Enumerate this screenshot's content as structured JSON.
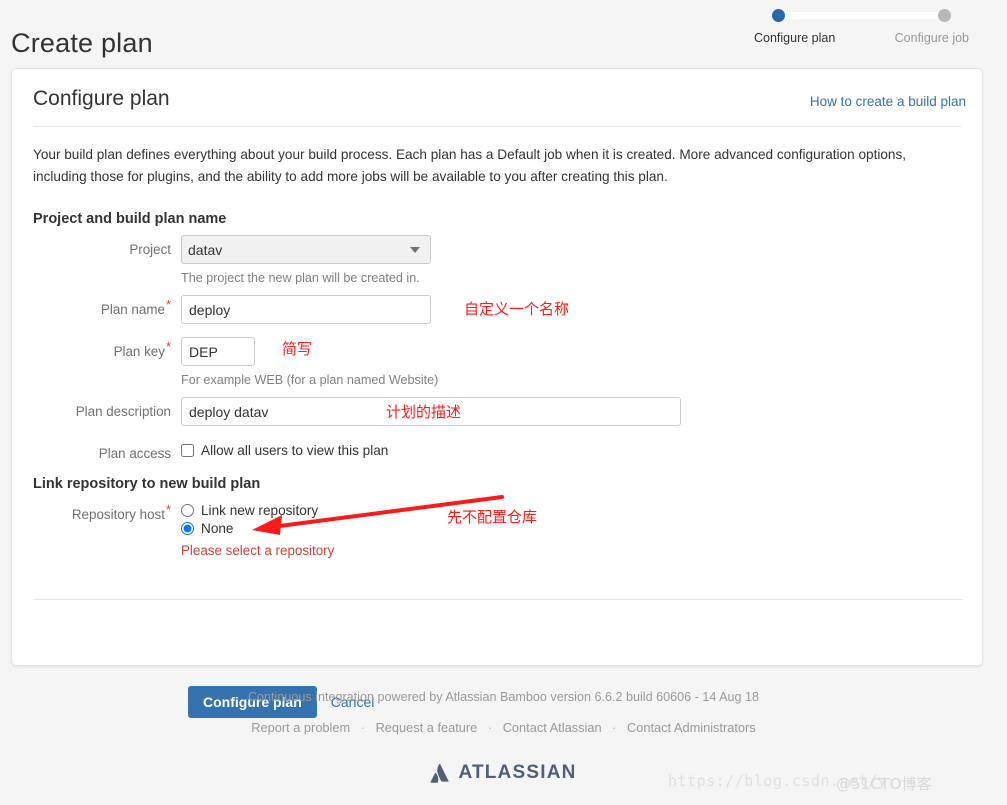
{
  "header": {
    "title": "Create plan",
    "steps": [
      {
        "label": "Configure plan",
        "state": "current"
      },
      {
        "label": "Configure job",
        "state": "upcoming"
      }
    ]
  },
  "card": {
    "title": "Configure plan",
    "help_link": "How to create a build plan",
    "intro": "Your build plan defines everything about your build process. Each plan has a Default job when it is created. More advanced configuration options, including those for plugins, and the ability to add more jobs will be available to you after creating this plan."
  },
  "form": {
    "section1_title": "Project and build plan name",
    "section2_title": "Link repository to new build plan",
    "project": {
      "label": "Project",
      "value": "datav",
      "options": [
        "datav"
      ],
      "hint": "The project the new plan will be created in."
    },
    "plan_name": {
      "label": "Plan name",
      "required": true,
      "value": "deploy",
      "placeholder": ""
    },
    "plan_key": {
      "label": "Plan key",
      "required": true,
      "value": "DEP",
      "placeholder": "",
      "hint": "For example WEB (for a plan named Website)"
    },
    "plan_description": {
      "label": "Plan description",
      "required": false,
      "value": "deploy datav",
      "placeholder": ""
    },
    "plan_access": {
      "label": "Plan access",
      "checkbox_label": "Allow all users to view this plan",
      "checked": false
    },
    "repository_host": {
      "label": "Repository host",
      "required": true,
      "options": [
        {
          "label": "Link new repository",
          "selected": false
        },
        {
          "label": "None",
          "selected": true
        }
      ],
      "error": "Please select a repository"
    }
  },
  "actions": {
    "submit_label": "Configure plan",
    "cancel_label": "Cancel"
  },
  "footer": {
    "credit": "Continuous integration powered by Atlassian Bamboo version 6.6.2 build 60606 - 14 Aug 18",
    "links": [
      "Report a problem",
      "Request a feature",
      "Contact Atlassian",
      "Contact Administrators"
    ],
    "separator": "·",
    "brand": "ATLASSIAN"
  },
  "annotations": {
    "plan_name": "自定义一个名称",
    "plan_key": "简写",
    "plan_description": "计划的描述",
    "repository": "先不配置仓库"
  },
  "watermark": {
    "url": "https://blog.csdn.net/y",
    "badge": "@51CTO博客"
  },
  "colors": {
    "accent": "#3572b0",
    "annotation": "#ff1a1a",
    "error": "#d04437",
    "page_bg": "#f5f5f5",
    "brand": "#505f79"
  }
}
